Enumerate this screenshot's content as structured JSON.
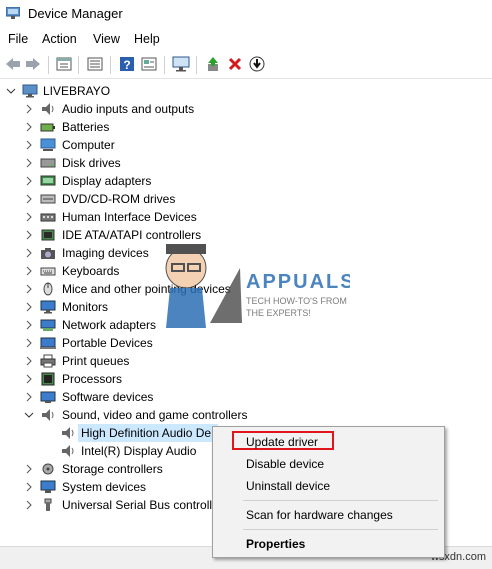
{
  "window": {
    "title": "Device Manager"
  },
  "menu": [
    {
      "label": "File"
    },
    {
      "label": "Action"
    },
    {
      "label": "View"
    },
    {
      "label": "Help"
    }
  ],
  "toolbar": {
    "buttons": [
      "back-icon",
      "forward-icon",
      "properties-icon",
      "show-hide-icon",
      "help-icon",
      "action-icon",
      "monitor-icon",
      "update-driver-icon",
      "uninstall-icon",
      "download-icon"
    ]
  },
  "tree": {
    "root": "LIVEBRAYO",
    "categories": [
      {
        "label": "Audio inputs and outputs",
        "icon": "speaker-icon"
      },
      {
        "label": "Batteries",
        "icon": "battery-icon"
      },
      {
        "label": "Computer",
        "icon": "computer-icon"
      },
      {
        "label": "Disk drives",
        "icon": "disk-icon"
      },
      {
        "label": "Display adapters",
        "icon": "display-adapter-icon"
      },
      {
        "label": "DVD/CD-ROM drives",
        "icon": "dvd-icon"
      },
      {
        "label": "Human Interface Devices",
        "icon": "hid-icon"
      },
      {
        "label": "IDE ATA/ATAPI controllers",
        "icon": "ide-icon"
      },
      {
        "label": "Imaging devices",
        "icon": "camera-icon"
      },
      {
        "label": "Keyboards",
        "icon": "keyboard-icon"
      },
      {
        "label": "Mice and other pointing devices",
        "icon": "mouse-icon"
      },
      {
        "label": "Monitors",
        "icon": "monitor-icon"
      },
      {
        "label": "Network adapters",
        "icon": "network-icon"
      },
      {
        "label": "Portable Devices",
        "icon": "portable-icon"
      },
      {
        "label": "Print queues",
        "icon": "printer-icon"
      },
      {
        "label": "Processors",
        "icon": "processor-icon"
      },
      {
        "label": "Software devices",
        "icon": "software-icon"
      },
      {
        "label": "Sound, video and game controllers",
        "icon": "speaker-icon"
      }
    ],
    "sound_children": [
      {
        "label": "High Definition Audio De"
      },
      {
        "label": "Intel(R) Display Audio"
      }
    ],
    "after": [
      {
        "label": "Storage controllers",
        "icon": "storage-icon"
      },
      {
        "label": "System devices",
        "icon": "system-icon"
      },
      {
        "label": "Universal Serial Bus controlle",
        "icon": "usb-icon"
      }
    ]
  },
  "context_menu": {
    "items": [
      {
        "label": "Update driver"
      },
      {
        "label": "Disable device"
      },
      {
        "label": "Uninstall device"
      },
      {
        "label": "Scan for hardware changes"
      },
      {
        "label": "Properties"
      }
    ]
  },
  "watermark": {
    "brand": "APPUALS",
    "tagline_1": "TECH HOW-TO'S FROM",
    "tagline_2": "THE EXPERTS!"
  },
  "corner": "wsxdn.com",
  "colors": {
    "selection": "#cce8ff",
    "highlight_border": "#e0161c",
    "accent": "#1f6fbf"
  }
}
